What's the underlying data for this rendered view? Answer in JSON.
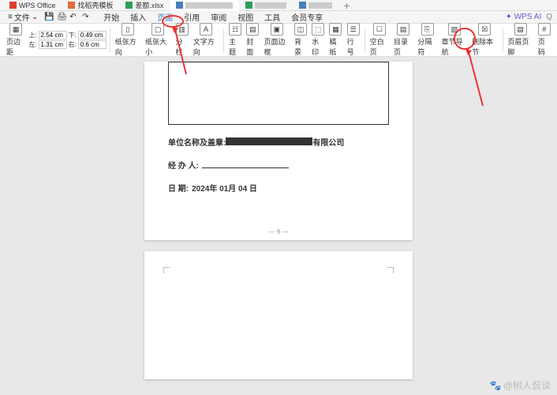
{
  "titlebar": {
    "tabs": [
      {
        "label": "WPS Office",
        "icon": "#e03e2d"
      },
      {
        "label": "找稻壳模板",
        "icon": "#e06b3e"
      },
      {
        "label": "差额.xlsx",
        "icon": "#2e9e5b"
      },
      {
        "label": "",
        "icon": "#4a7ebb"
      },
      {
        "label": "",
        "icon": "#2e9e5b"
      },
      {
        "label": "",
        "icon": "#4a7ebb"
      }
    ]
  },
  "menubar": {
    "file": "文件",
    "tabs": [
      "开始",
      "插入",
      "页面",
      "引用",
      "审阅",
      "视图",
      "工具",
      "会员专享"
    ],
    "active_index": 2,
    "right": [
      "WPS AI",
      "Q"
    ]
  },
  "ribbon": {
    "margins": {
      "btn": "页边距",
      "top_lbl": "上:",
      "top_val": "2.54 cm",
      "bottom_lbl": "下:",
      "bottom_val": "0.49 cm",
      "left_lbl": "左:",
      "left_val": "1.31 cm",
      "right_lbl": "右:",
      "right_val": "0.6 cm"
    },
    "buttons": {
      "orient": "纸张方向",
      "size": "纸张大小",
      "columns": "分栏",
      "textdir": "文字方向",
      "theme": "主题",
      "cover": "封面",
      "border": "页面边框",
      "bg": "背景",
      "watermark": "水印",
      "line": "稿纸",
      "lineno": "行号",
      "blank": "空白页",
      "toc": "目录页",
      "break": "分隔符",
      "secnav": "章节导航",
      "delsec": "删除本节",
      "hf": "页眉页脚",
      "pagenum": "页码"
    }
  },
  "doc": {
    "field1_label": "单位名称及盖章:",
    "field1_suffix": "有限公司",
    "field2_label": "经 办 人:",
    "field3_label": "日    期:",
    "field3_value": "2024年 01月 04 日",
    "pagenum": "— 9 —"
  },
  "watermark": "@树人侃谈"
}
